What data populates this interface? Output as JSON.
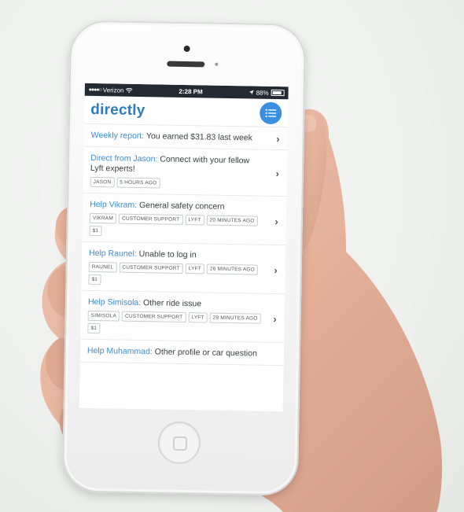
{
  "status_bar": {
    "signal": "●●●●○",
    "carrier": "Verizon",
    "wifi_icon": "wifi-icon",
    "time": "2:28 PM",
    "location_icon": "location-arrow-icon",
    "battery_text": "88%",
    "battery_level": 0.88
  },
  "app": {
    "brand": "directly",
    "menu_icon": "list-icon",
    "colors": {
      "brand": "#2b7dbf",
      "accent": "#3a8fe0",
      "status_bar": "#232a33"
    }
  },
  "feed": [
    {
      "who": "Weekly report:",
      "text": " You earned $31.83 last week",
      "tags": []
    },
    {
      "who": "Direct from Jason:",
      "text": " Connect with your fellow Lyft experts!",
      "tags": [
        "JASON",
        "5 HOURS AGO"
      ]
    },
    {
      "who": "Help Vikram:",
      "text": " General safety concern",
      "tags": [
        "VIKRAM",
        "CUSTOMER SUPPORT",
        "LYFT",
        "20 MINUTES AGO",
        "$1"
      ]
    },
    {
      "who": "Help Raunel:",
      "text": " Unable to log in",
      "tags": [
        "RAUNEL",
        "CUSTOMER SUPPORT",
        "LYFT",
        "26 MINUTES AGO",
        "$1"
      ]
    },
    {
      "who": "Help Simisola:",
      "text": " Other ride issue",
      "tags": [
        "SIMISOLA",
        "CUSTOMER SUPPORT",
        "LYFT",
        "29 MINUTES AGO",
        "$1"
      ]
    },
    {
      "who": "Help Muhammad:",
      "text": " Other profile or car question",
      "tags": []
    }
  ]
}
